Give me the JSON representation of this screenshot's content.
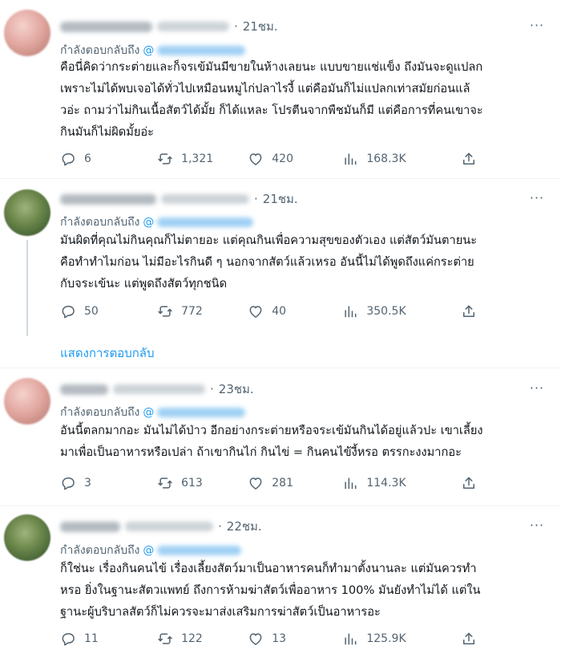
{
  "tweets": [
    {
      "time": "21ชม.",
      "replying_label": "กำลังตอบกลับถึง",
      "mention_prefix": "@",
      "lines": [
        "คือนี่คิดว่ากระต่ายและก็จรเข้มันมีขายในห้างเลยนะ แบบขายแช่แข็ง ถึงมันจะดูแปลก",
        "เพราะไม่ได้พบเจอได้ทั่วไปเหมือนหมูไก่ปลาไรงี้ แต่คือมันก็ไม่แปลกเท่าสมัยก่อนแล้",
        "วอ่ะ ถามว่าไม่กินเนื้อสัตว์ได้มั้ย ก็ได้แหละ โปรตีนจากพืชมันก็มี แต่คือการที่คนเขาจะ",
        "กินมันก็ไม่ผิดมั้ยอ่ะ"
      ],
      "replies": "6",
      "retweets": "1,321",
      "likes": "420",
      "views": "168.3K"
    },
    {
      "time": "21ชม.",
      "replying_label": "กำลังตอบกลับถึง",
      "mention_prefix": "@",
      "lines": [
        "มันผิดที่คุณไม่กินคุณก็ไม่ตายอะ แต่คุณกินเพื่อความสุขของตัวเอง แต่สัตว์มันตายนะ",
        "คือทำทำไมก่อน ไม่มีอะไรกินดี ๆ นอกจากสัตว์แล้วเหรอ อันนี้ไม่ได้พูดถึงแค่กระต่าย",
        "กับจระเข้นะ แต่พูดถึงสัตว์ทุกชนิด"
      ],
      "replies": "50",
      "retweets": "772",
      "likes": "40",
      "views": "350.5K"
    },
    {
      "time": "23ชม.",
      "replying_label": "กำลังตอบกลับถึง",
      "mention_prefix": "@",
      "lines": [
        "อันนี้ตลกมากอะ มันไม่ได้ป่าว อีกอย่างกระต่ายหรือจระเข้มันกินได้อยู่แล้วปะ เขาเลี้ยง",
        "มาเพื่อเป็นอาหารหรือเปล่า ถ้าเขากินไก่ กินไข่ = กินคนไข้งี้หรอ ตรรกะงงมากอะ"
      ],
      "replies": "3",
      "retweets": "613",
      "likes": "281",
      "views": "114.3K"
    },
    {
      "time": "22ชม.",
      "replying_label": "กำลังตอบกลับถึง",
      "mention_prefix": "@",
      "lines": [
        "ก็ใช่นะ เรื่องกินคนไข้ เรื่องเลี้ยงสัตว์มาเป็นอาหารคนก็ทำมาตั้งนานละ แต่มันควรทำ",
        "หรอ ยิ่งในฐานะสัตวแพทย์ ถึงการห้ามฆ่าสัตว์เพื่ออาหาร 100% มันยังทำไม่ได้ แต่ใน",
        "ฐานะผู้บริบาลสัตว์ก็ไม่ควรจะมาส่งเสริมการฆ่าสัตว์เป็นอาหารอะ"
      ],
      "replies": "11",
      "retweets": "122",
      "likes": "13",
      "views": "125.9K"
    }
  ],
  "show_replies": "แสดงการตอบกลับ",
  "icons": {
    "reply": "reply-icon",
    "retweet": "retweet-icon",
    "like": "heart-icon",
    "views": "views-icon",
    "share": "share-icon"
  },
  "colors": {
    "link": "#1d9bf0",
    "secondary": "#536471",
    "text": "#0f1419"
  }
}
